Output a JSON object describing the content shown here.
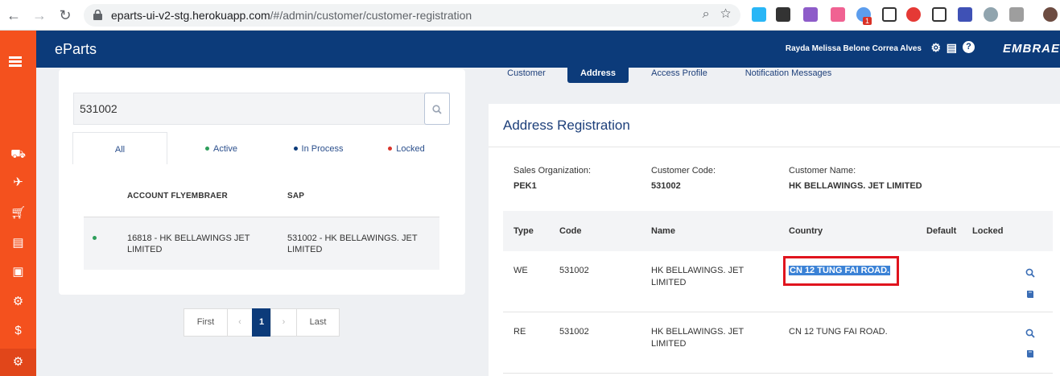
{
  "browser": {
    "url_host": "eparts-ui-v2-stg.herokuapp.com",
    "url_path": "/#/admin/customer/customer-registration",
    "extension_badge": "1"
  },
  "app": {
    "brand": "eParts",
    "user_name": "Rayda Melissa Belone Correa Alves",
    "logo_text": "EMBRAE"
  },
  "search": {
    "value": "531002"
  },
  "filters": [
    "All",
    "Active",
    "In Process",
    "Locked"
  ],
  "filter_colors": {
    "active": "#2e9e5b",
    "in_process": "#0c3b7a",
    "locked": "#d9342b"
  },
  "accounts_table": {
    "headers": [
      "ACCOUNT FLYEMBRAER",
      "SAP"
    ],
    "rows": [
      {
        "account": "16818 - HK BELLAWINGS JET LIMITED",
        "sap": "531002 - HK BELLAWINGS. JET LIMITED"
      }
    ]
  },
  "pagination": {
    "first": "First",
    "prev": "‹",
    "current": "1",
    "next": "›",
    "last": "Last"
  },
  "tabs": [
    "Customer",
    "Address",
    "Access Profile",
    "Notification Messages"
  ],
  "address": {
    "title": "Address Registration",
    "sales_org_label": "Sales Organization:",
    "sales_org": "PEK1",
    "customer_code_label": "Customer Code:",
    "customer_code": "531002",
    "customer_name_label": "Customer Name:",
    "customer_name": "HK BELLAWINGS. JET LIMITED",
    "headers": [
      "Type",
      "Code",
      "Name",
      "Country",
      "Default",
      "Locked"
    ],
    "rows": [
      {
        "type": "WE",
        "code": "531002",
        "name": "HK BELLAWINGS. JET LIMITED",
        "country": "CN 12 TUNG FAI ROAD."
      },
      {
        "type": "RE",
        "code": "531002",
        "name": "HK BELLAWINGS. JET LIMITED",
        "country": "CN 12 TUNG FAI ROAD."
      }
    ]
  }
}
